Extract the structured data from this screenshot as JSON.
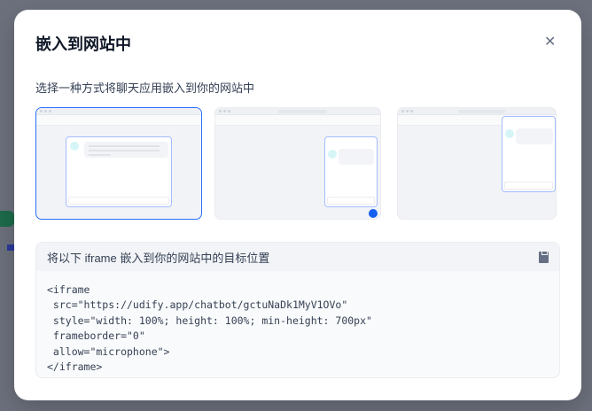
{
  "dialog": {
    "title": "嵌入到网站中",
    "close_icon": "close-icon",
    "subtitle": "选择一种方式将聊天应用嵌入到你的网站中"
  },
  "options": [
    {
      "name": "fullscreen",
      "selected": true
    },
    {
      "name": "bubble-button",
      "selected": false
    },
    {
      "name": "chrome-extension",
      "selected": false
    }
  ],
  "code_block": {
    "header": "将以下 iframe 嵌入到你的网站中的目标位置",
    "copy_icon": "clipboard-icon",
    "code": "<iframe\n src=\"https://udify.app/chatbot/gctuNaDk1MyV1OVo\"\n style=\"width: 100%; height: 100%; min-height: 700px\"\n frameborder=\"0\"\n allow=\"microphone\">\n</iframe>"
  },
  "colors": {
    "accent": "#2970ff",
    "overlay": "#6c717d"
  }
}
